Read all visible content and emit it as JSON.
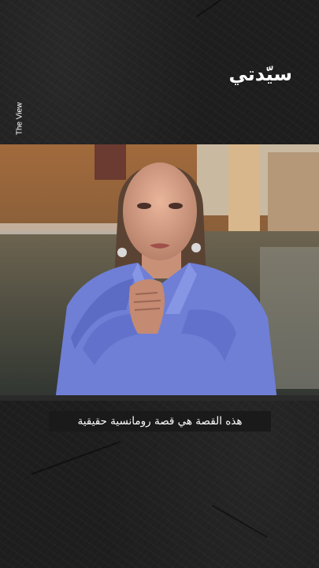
{
  "brand": {
    "logo_text": "سيّدتي",
    "logo_color": "#ffffff"
  },
  "source": {
    "label": "The View"
  },
  "video": {
    "description_icon": "video-frame",
    "caption": "هذه القصة هي قصة رومانسية حقيقية"
  },
  "colors": {
    "background": "#1e1e1e",
    "caption_bg": "#1a1a1a",
    "shirt": "#6f7fd6"
  }
}
